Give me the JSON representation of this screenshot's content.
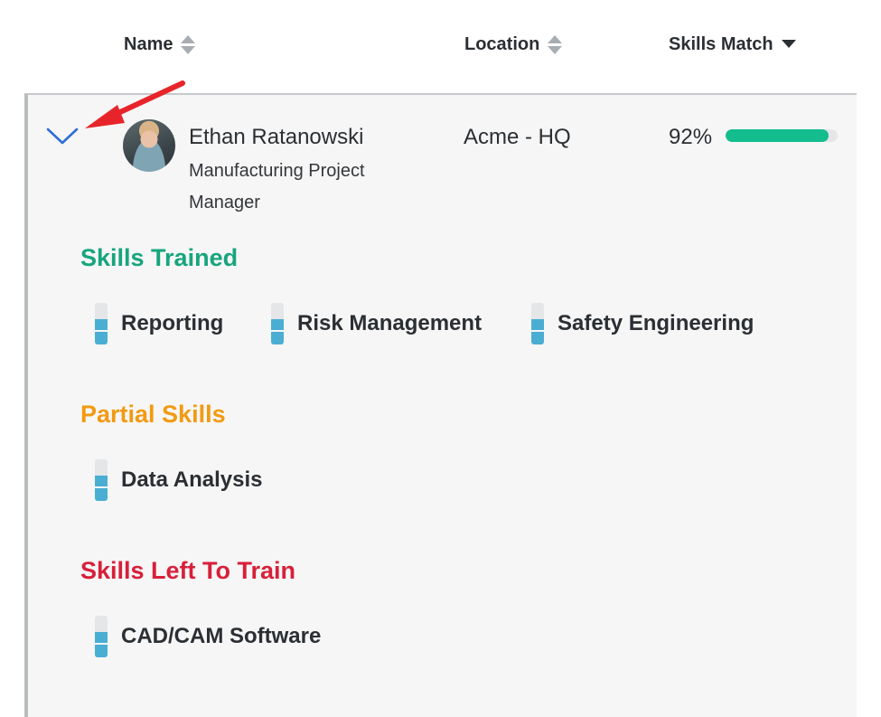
{
  "columns": {
    "name": "Name",
    "location": "Location",
    "skills_match": "Skills Match"
  },
  "row": {
    "name": "Ethan Ratanowski",
    "role": "Manufacturing Project Manager",
    "location": "Acme - HQ",
    "match_label": "92%",
    "match_value": 0.92
  },
  "sections": {
    "trained": {
      "title": "Skills Trained",
      "skills": [
        "Reporting",
        "Risk Management",
        "Safety Engineering"
      ]
    },
    "partial": {
      "title": "Partial Skills",
      "skills": [
        "Data Analysis"
      ]
    },
    "left": {
      "title": "Skills Left To Train",
      "skills": [
        "CAD/CAM Software"
      ]
    }
  },
  "colors": {
    "trained": "#17a57d",
    "partial": "#f29a12",
    "left": "#d8203a",
    "match_bar": "#14bd8d",
    "chevron": "#2f6fd6",
    "annotation_arrow": "#e8242b"
  },
  "icons": {
    "name_sort": "sort-both-icon",
    "location_sort": "sort-both-icon",
    "skills_sort": "sort-desc-icon",
    "expand": "chevron-down-icon",
    "skill_level": "skill-level-icon"
  }
}
